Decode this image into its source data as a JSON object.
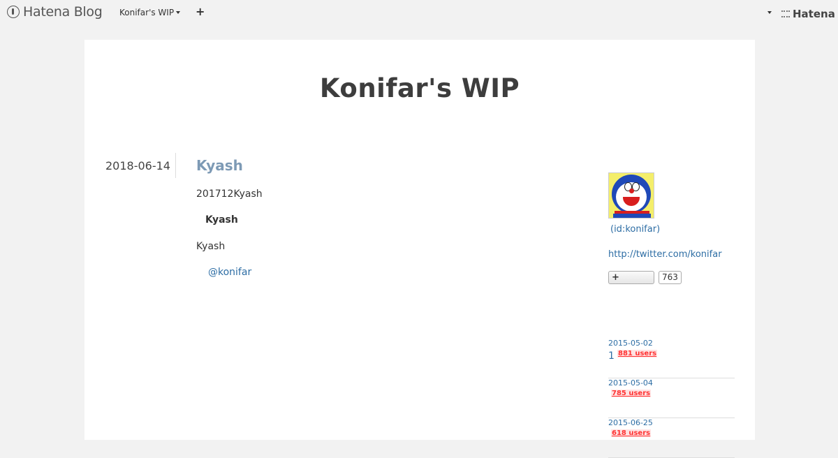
{
  "topbar": {
    "logo_text": "Hatena Blog",
    "blog_menu_label": "Konifar's WIP",
    "plus_label": "+",
    "hatena_label": "Hatena"
  },
  "blog": {
    "title": "Konifar's WIP"
  },
  "entry": {
    "date": "2018-06-14",
    "title": "Kyash",
    "paragraph1": "201712Kyash",
    "heading": "Kyash",
    "paragraph2": "Kyash",
    "link": "@konifar"
  },
  "sidebar": {
    "user_id": "(id:konifar)",
    "twitter_link": "http://twitter.com/konifar",
    "subscribe_label": "+",
    "subscriber_count": "763",
    "popular": [
      {
        "date": "2015-05-02",
        "title": "1",
        "users": "881 users"
      },
      {
        "date": "2015-05-04",
        "title": "",
        "users": "785 users"
      },
      {
        "date": "2015-06-25",
        "title": "",
        "users": "618 users"
      }
    ]
  },
  "colors": {
    "page_bg": "#f2f2f2",
    "link": "#2d6da4",
    "entry_title": "#7d9ab5",
    "users_badge": "#ff3333"
  }
}
